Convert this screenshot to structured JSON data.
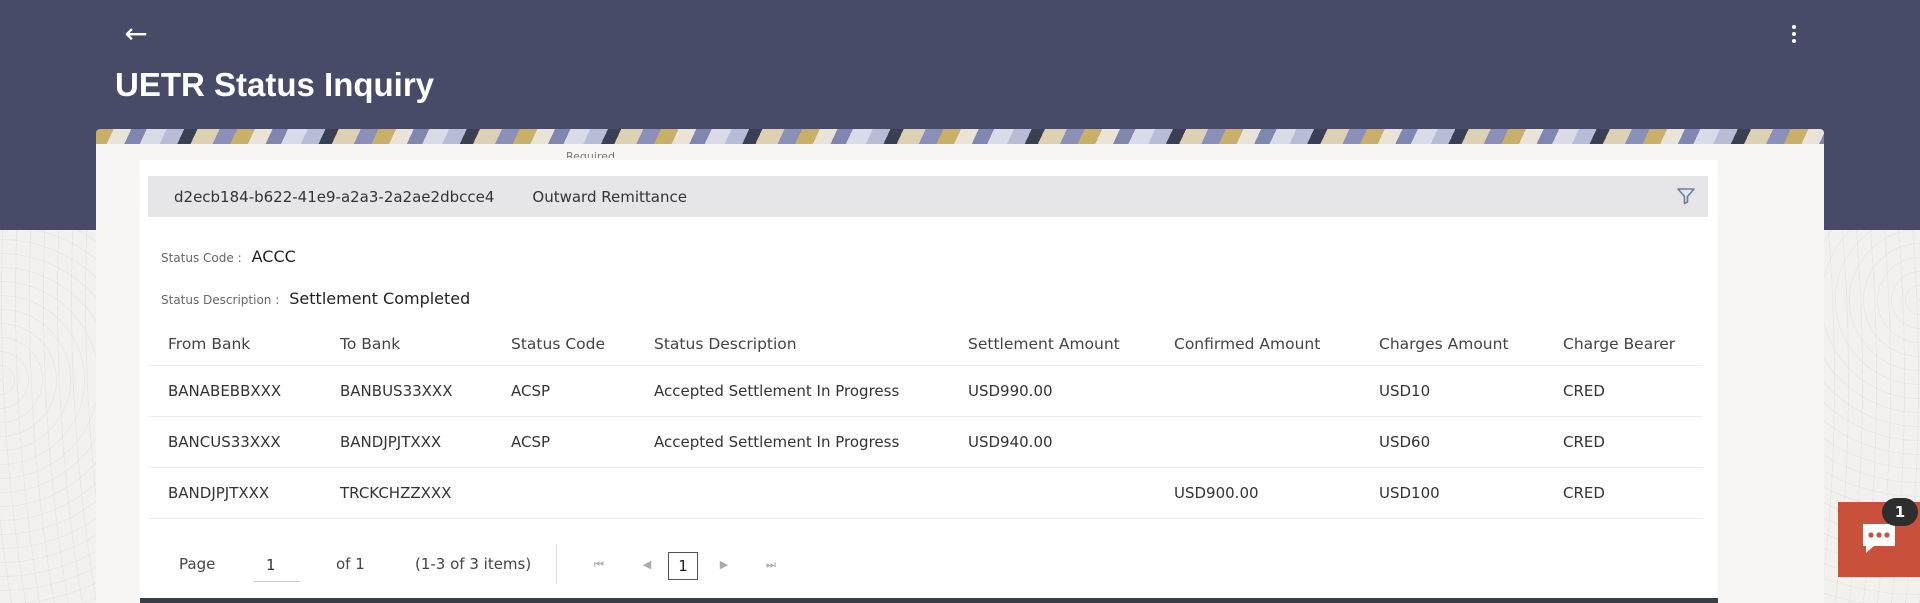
{
  "header": {
    "title": "UETR Status Inquiry",
    "back_label": "←"
  },
  "search": {
    "cut_label": "Required",
    "uetr": "d2ecb184-b622-41e9-a2a3-2a2ae2dbcce4",
    "transaction_type": "Outward Remittance"
  },
  "summary": {
    "status_code_label": "Status Code :",
    "status_code_value": "ACCC",
    "status_desc_label": "Status Description :",
    "status_desc_value": "Settlement Completed"
  },
  "table": {
    "columns": [
      "From Bank",
      "To Bank",
      "Status Code",
      "Status Description",
      "Settlement Amount",
      "Confirmed Amount",
      "Charges Amount",
      "Charge Bearer"
    ],
    "rows": [
      [
        "BANABEBBXXX",
        "BANBUS33XXX",
        "ACSP",
        "Accepted Settlement In Progress",
        "USD990.00",
        "",
        "USD10",
        "CRED"
      ],
      [
        "BANCUS33XXX",
        "BANDJPJTXXX",
        "ACSP",
        "Accepted Settlement In Progress",
        "USD940.00",
        "",
        "USD60",
        "CRED"
      ],
      [
        "BANDJPJTXXX",
        "TRCKCHZZXXX",
        "",
        "",
        "",
        "USD900.00",
        "USD100",
        "CRED"
      ]
    ]
  },
  "pagination": {
    "page_label": "Page",
    "page_value": "1",
    "of_label": "of 1",
    "items_label": "(1-3 of 3 items)",
    "current_page": "1",
    "first_icon": "⏮",
    "prev_icon": "◀",
    "next_icon": "▶",
    "last_icon": "⏭"
  },
  "chat": {
    "badge_count": "1"
  },
  "colors": {
    "header_bg": "#474b68",
    "chat_bg": "#c9503b"
  },
  "icons": {
    "back": "back-arrow-icon",
    "menu": "kebab-menu-icon",
    "filter": "filter-icon",
    "chat": "chat-bubble-icon"
  }
}
